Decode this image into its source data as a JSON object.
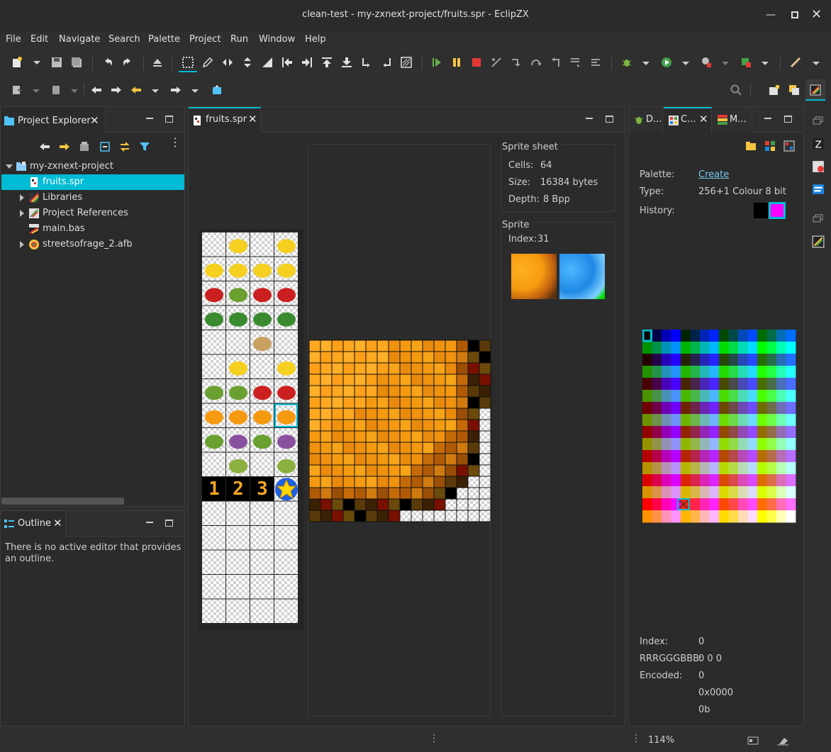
{
  "window": {
    "title": "clean-test - my-zxnext-project/fruits.spr - EclipZX"
  },
  "menu": [
    "File",
    "Edit",
    "Navigate",
    "Search",
    "Palette",
    "Project",
    "Run",
    "Window",
    "Help"
  ],
  "project_explorer": {
    "tab_label": "Project Explorer",
    "items": [
      {
        "label": "my-zxnext-project"
      },
      {
        "label": "fruits.spr"
      },
      {
        "label": "Libraries"
      },
      {
        "label": "Project References"
      },
      {
        "label": "main.bas"
      },
      {
        "label": "streetsofrage_2.afb"
      }
    ]
  },
  "outline": {
    "tab_label": "Outline",
    "message": "There is no active editor that provides an outline."
  },
  "editor": {
    "tab_label": "fruits.spr",
    "sheet": {
      "heading": "Sprite sheet",
      "cells_label": "Cells:",
      "cells_value": "64",
      "size_label": "Size:",
      "size_value": "16384 bytes",
      "depth_label": "Depth:",
      "depth_value": "8 Bpp"
    },
    "sprite": {
      "heading": "Sprite",
      "index_label": "Index:",
      "index_value": "31"
    },
    "thumb_digits": [
      "1",
      "2",
      "3"
    ]
  },
  "right_panel": {
    "tabs": [
      {
        "label": "D..."
      },
      {
        "label": "C..."
      },
      {
        "label": "M..."
      }
    ],
    "palette_label": "Palette:",
    "palette_link": "Create",
    "type_label": "Type:",
    "type_value": "256+1 Colour 8 bit",
    "history_label": "History:",
    "history_colors": [
      "#000000",
      "#ff00ff"
    ],
    "index_label": "Index:",
    "index_value": "0",
    "rgb_label": "RRRGGGBBB:",
    "rgb_value": "0 0 0",
    "encoded_label": "Encoded:",
    "encoded_value": "0",
    "hex_value": "0x0000",
    "bin_value": "0b"
  },
  "status": {
    "zoom": "114%"
  },
  "colors": {
    "accent": "#00bcd4",
    "selection": "#00bcd4"
  }
}
